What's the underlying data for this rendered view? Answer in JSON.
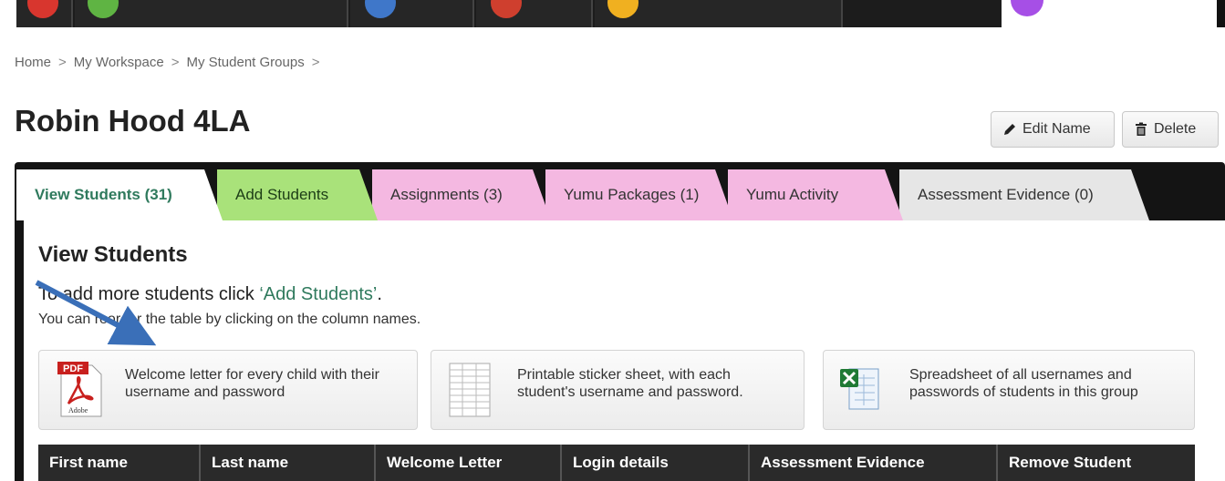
{
  "breadcrumb": {
    "items": [
      "Home",
      "My Workspace",
      "My Student Groups"
    ],
    "separator": ">"
  },
  "page": {
    "title": "Robin Hood 4LA"
  },
  "header_buttons": {
    "edit_label": "Edit Name",
    "delete_label": "Delete"
  },
  "tabs": [
    {
      "label": "View Students (31)",
      "color": "#ffffff"
    },
    {
      "label": "Add Students",
      "color": "#a9e27a"
    },
    {
      "label": "Assignments (3)",
      "color": "#f4b8e1"
    },
    {
      "label": "Yumu Packages (1)",
      "color": "#f4b8e1"
    },
    {
      "label": "Yumu Activity",
      "color": "#f4b8e1"
    },
    {
      "label": "Assessment Evidence (0)",
      "color": "#e6e6e6"
    }
  ],
  "section": {
    "title": "View Students",
    "instruction_prefix": "To add more students click ",
    "instruction_link": "‘Add Students’",
    "instruction_suffix": ".",
    "reorder_hint": "You can reorder the table by clicking on the column names."
  },
  "downloads": [
    {
      "icon": "pdf-icon",
      "text": "Welcome letter for every child with their username and password"
    },
    {
      "icon": "sticker-sheet-icon",
      "text": "Printable sticker sheet, with each student's username and password."
    },
    {
      "icon": "excel-icon",
      "text": "Spreadsheet of all usernames and passwords of students in this group"
    }
  ],
  "table": {
    "columns": [
      "First name",
      "Last name",
      "Welcome Letter",
      "Login details",
      "Assessment Evidence",
      "Remove Student"
    ]
  },
  "pdf_icon_label": "PDF",
  "pdf_icon_brand": "Adobe",
  "colors": {
    "accent_green": "#2f7a5d",
    "arrow_blue": "#3a6fb8"
  }
}
